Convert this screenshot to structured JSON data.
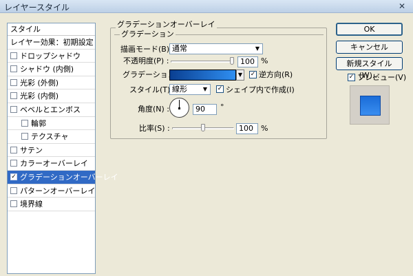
{
  "window": {
    "title": "レイヤースタイル",
    "close_glyph": "✕"
  },
  "style_list": {
    "header": "スタイル",
    "items": [
      {
        "label": "レイヤー効果：初期設定",
        "checkbox": false,
        "sub": false,
        "checked": false,
        "selected": false
      },
      {
        "label": "ドロップシャドウ",
        "checkbox": true,
        "sub": false,
        "checked": false,
        "selected": false
      },
      {
        "label": "シャドウ (内側)",
        "checkbox": true,
        "sub": false,
        "checked": false,
        "selected": false
      },
      {
        "label": "光彩 (外側)",
        "checkbox": true,
        "sub": false,
        "checked": false,
        "selected": false
      },
      {
        "label": "光彩 (内側)",
        "checkbox": true,
        "sub": false,
        "checked": false,
        "selected": false
      },
      {
        "label": "ベベルとエンボス",
        "checkbox": true,
        "sub": false,
        "checked": false,
        "selected": false
      },
      {
        "label": "輪郭",
        "checkbox": true,
        "sub": true,
        "checked": false,
        "selected": false
      },
      {
        "label": "テクスチャ",
        "checkbox": true,
        "sub": true,
        "checked": false,
        "selected": false
      },
      {
        "label": "サテン",
        "checkbox": true,
        "sub": false,
        "checked": false,
        "selected": false
      },
      {
        "label": "カラーオーバーレイ",
        "checkbox": true,
        "sub": false,
        "checked": false,
        "selected": false
      },
      {
        "label": "グラデーションオーバーレイ",
        "checkbox": true,
        "sub": false,
        "checked": true,
        "selected": true
      },
      {
        "label": "パターンオーバーレイ",
        "checkbox": true,
        "sub": false,
        "checked": false,
        "selected": false
      },
      {
        "label": "境界線",
        "checkbox": true,
        "sub": false,
        "checked": false,
        "selected": false
      }
    ]
  },
  "panel": {
    "group_title": "グラデーションオーバーレイ",
    "inner_title": "グラデーション",
    "blend_mode": {
      "label": "描画モード(B) :",
      "value": "通常"
    },
    "opacity": {
      "label": "不透明度(P) :",
      "value": "100",
      "unit": "%",
      "level_percent": 100
    },
    "gradient": {
      "label": "グラデーション :",
      "color_start": "#0a3f91",
      "color_end": "#2f8ff2"
    },
    "reverse": {
      "label": "逆方向(R)",
      "checked": true,
      "check_glyph": "✓"
    },
    "style": {
      "label": "スタイル(T) :",
      "value": "線形"
    },
    "align_with_layer": {
      "label": "シェイプ内で作成(I)",
      "checked": true,
      "check_glyph": "✓"
    },
    "angle": {
      "label": "角度(N) :",
      "value": "90",
      "unit": "°"
    },
    "scale": {
      "label": "比率(S) :",
      "value": "100",
      "unit": "%",
      "level_percent": 50
    }
  },
  "buttons": {
    "ok": "OK",
    "cancel": "キャンセル",
    "new_style": "新規スタイル(W)...",
    "preview": {
      "label": "プレビュー(V)",
      "checked": true,
      "check_glyph": "✓"
    }
  },
  "colors": {
    "selection": "#316ac5",
    "preview_swatch": "#1a6cd8"
  }
}
